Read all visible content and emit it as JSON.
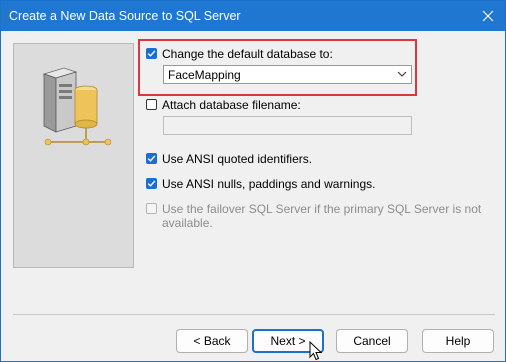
{
  "window": {
    "title": "Create a New Data Source to SQL Server"
  },
  "options": {
    "change_db": {
      "label": "Change the default database to:",
      "checked": true
    },
    "database_select": {
      "value": "FaceMapping"
    },
    "attach_db": {
      "label": "Attach database filename:",
      "checked": false
    },
    "attach_field": {
      "value": ""
    },
    "ansi_quoted": {
      "label": "Use ANSI quoted identifiers.",
      "checked": true
    },
    "ansi_nulls": {
      "label": "Use ANSI nulls, paddings and warnings.",
      "checked": true
    },
    "failover": {
      "label_line1": "Use the failover SQL Server if the primary SQL Server is not",
      "label_line2": "available.",
      "checked": false,
      "enabled": false
    }
  },
  "buttons": {
    "back": "< Back",
    "next": "Next >",
    "cancel": "Cancel",
    "help": "Help"
  },
  "colors": {
    "accent": "#1a6fd0",
    "titlebar": "#1f77d1",
    "highlight": "#d9393e"
  }
}
